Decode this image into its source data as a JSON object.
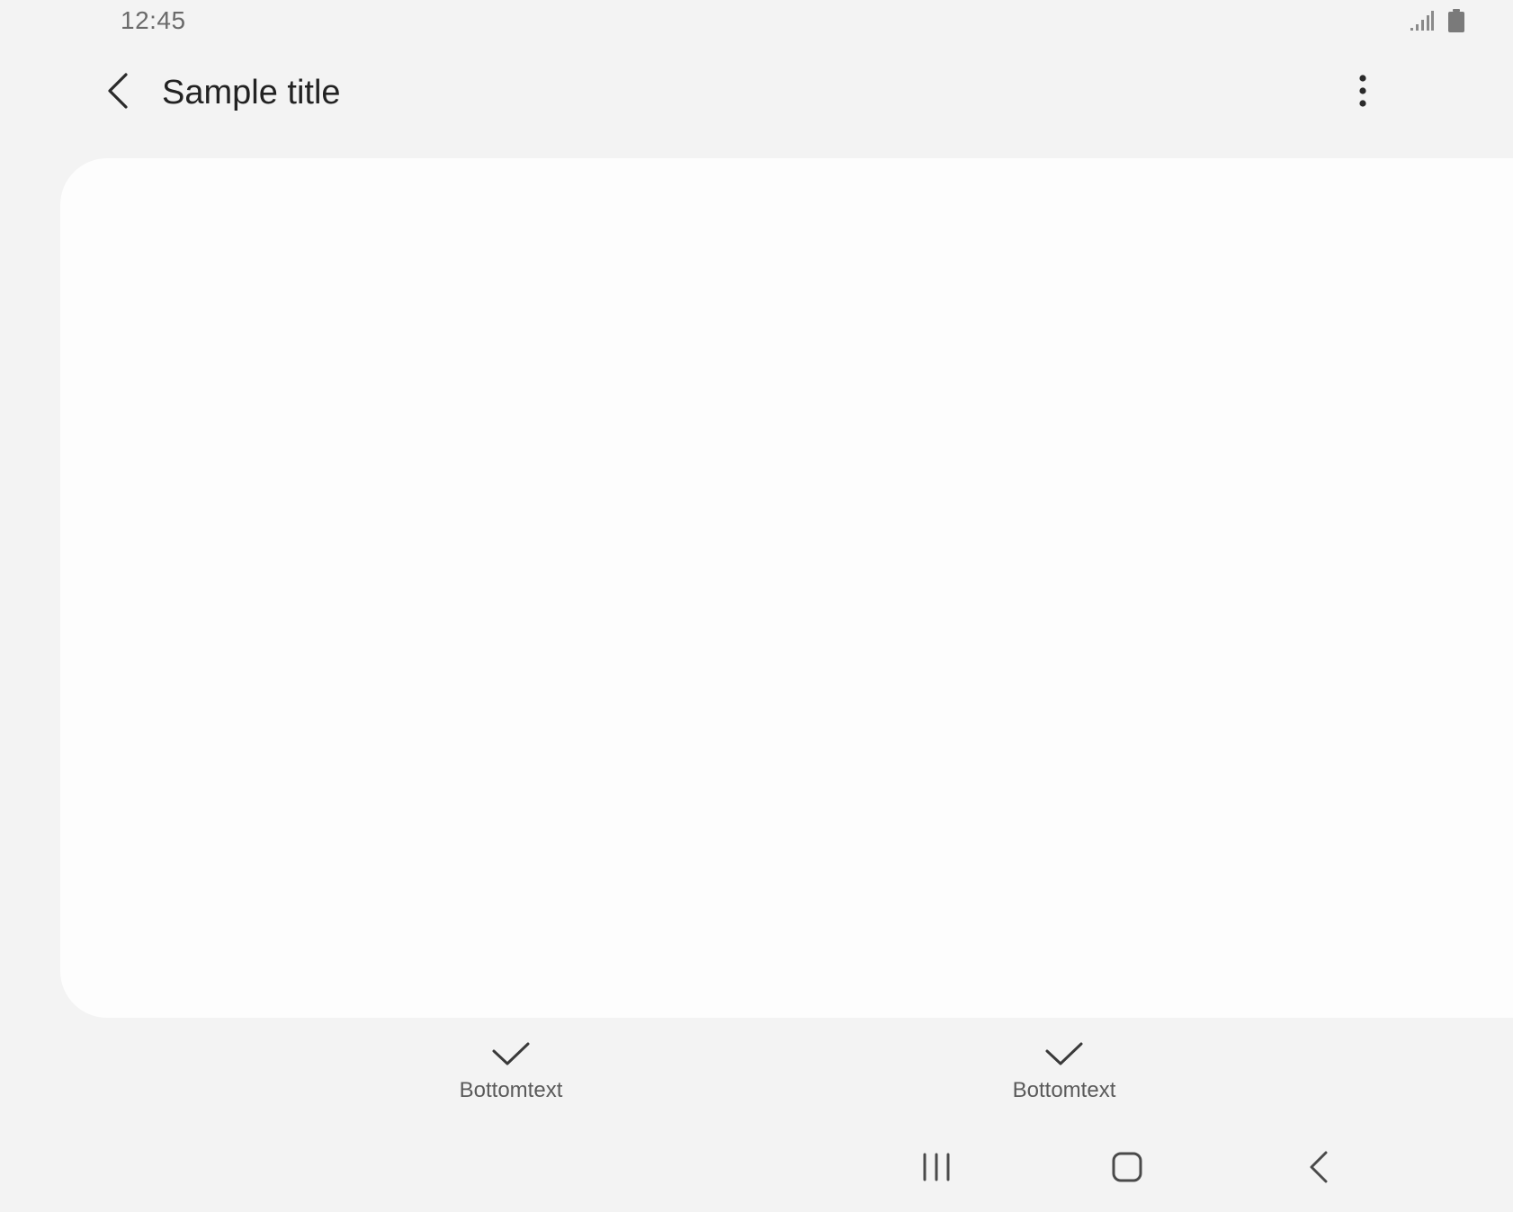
{
  "status_bar": {
    "time": "12:45",
    "icons": [
      "signal-icon",
      "battery-icon"
    ]
  },
  "app_bar": {
    "title": "Sample title",
    "back_icon": "chevron-left-icon",
    "more_icon": "more-vertical-icon"
  },
  "bottom_actions": [
    {
      "icon": "check-icon",
      "label": "Bottomtext"
    },
    {
      "icon": "check-icon",
      "label": "Bottomtext"
    }
  ],
  "navigation_bar": {
    "buttons": [
      "recent-apps-icon",
      "home-icon",
      "back-icon"
    ]
  },
  "colors": {
    "background": "#f3f3f3",
    "card": "#fdfdfd",
    "title_text": "#222222",
    "secondary_text": "#5a5a5a",
    "icon": "#4a4a4a"
  }
}
